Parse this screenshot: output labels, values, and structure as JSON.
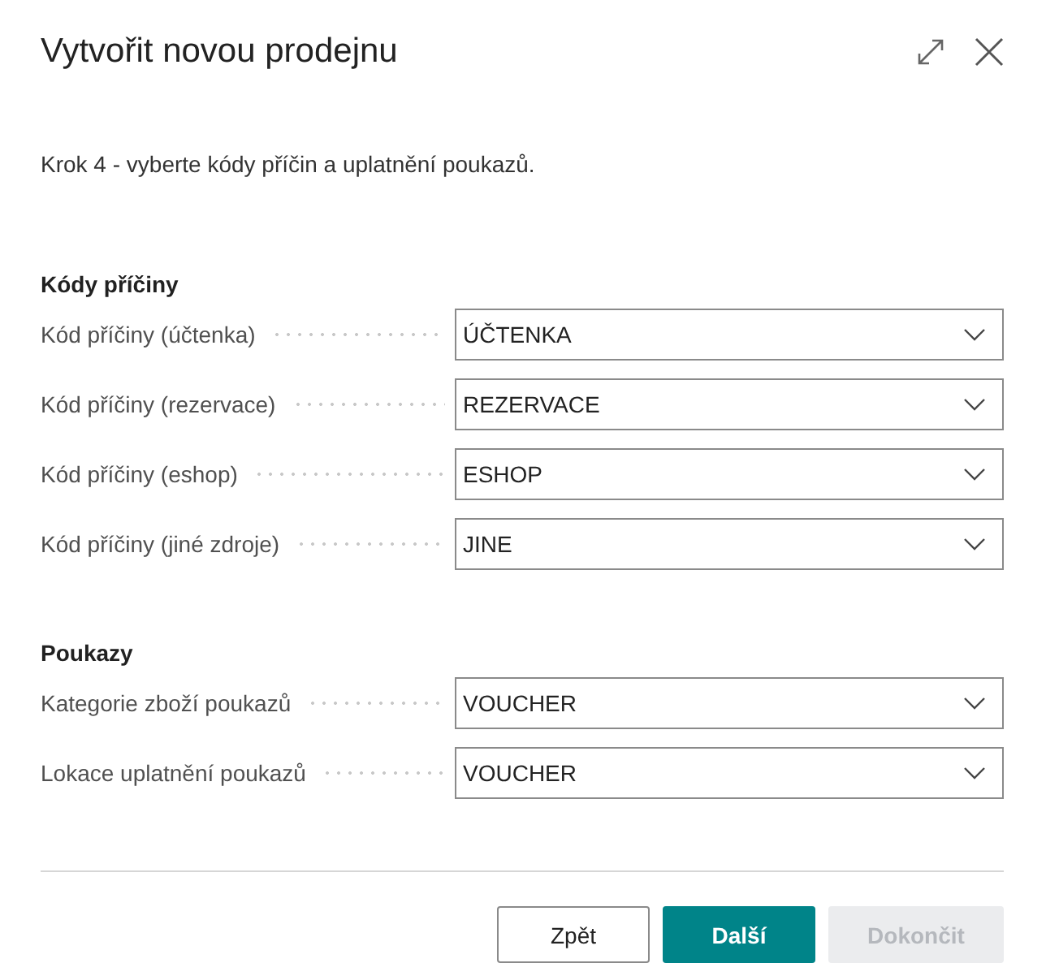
{
  "dialog": {
    "title": "Vytvořit novou prodejnu",
    "instruction": "Krok 4 - vyberte kódy příčin a uplatnění poukazů."
  },
  "sections": [
    {
      "heading": "Kódy příčiny",
      "fields": [
        {
          "label": "Kód příčiny (účtenka)",
          "value": "ÚČTENKA"
        },
        {
          "label": "Kód příčiny (rezervace)",
          "value": "REZERVACE"
        },
        {
          "label": "Kód příčiny (eshop)",
          "value": "ESHOP"
        },
        {
          "label": "Kód příčiny (jiné zdroje)",
          "value": "JINE"
        }
      ]
    },
    {
      "heading": "Poukazy",
      "fields": [
        {
          "label": "Kategorie zboží poukazů",
          "value": "VOUCHER"
        },
        {
          "label": "Lokace uplatnění poukazů",
          "value": "VOUCHER"
        }
      ]
    }
  ],
  "buttons": [
    {
      "label": "Zpět",
      "kind": "secondary",
      "disabled": false
    },
    {
      "label": "Další",
      "kind": "primary",
      "disabled": false
    },
    {
      "label": "Dokončit",
      "kind": "secondary",
      "disabled": true
    }
  ]
}
